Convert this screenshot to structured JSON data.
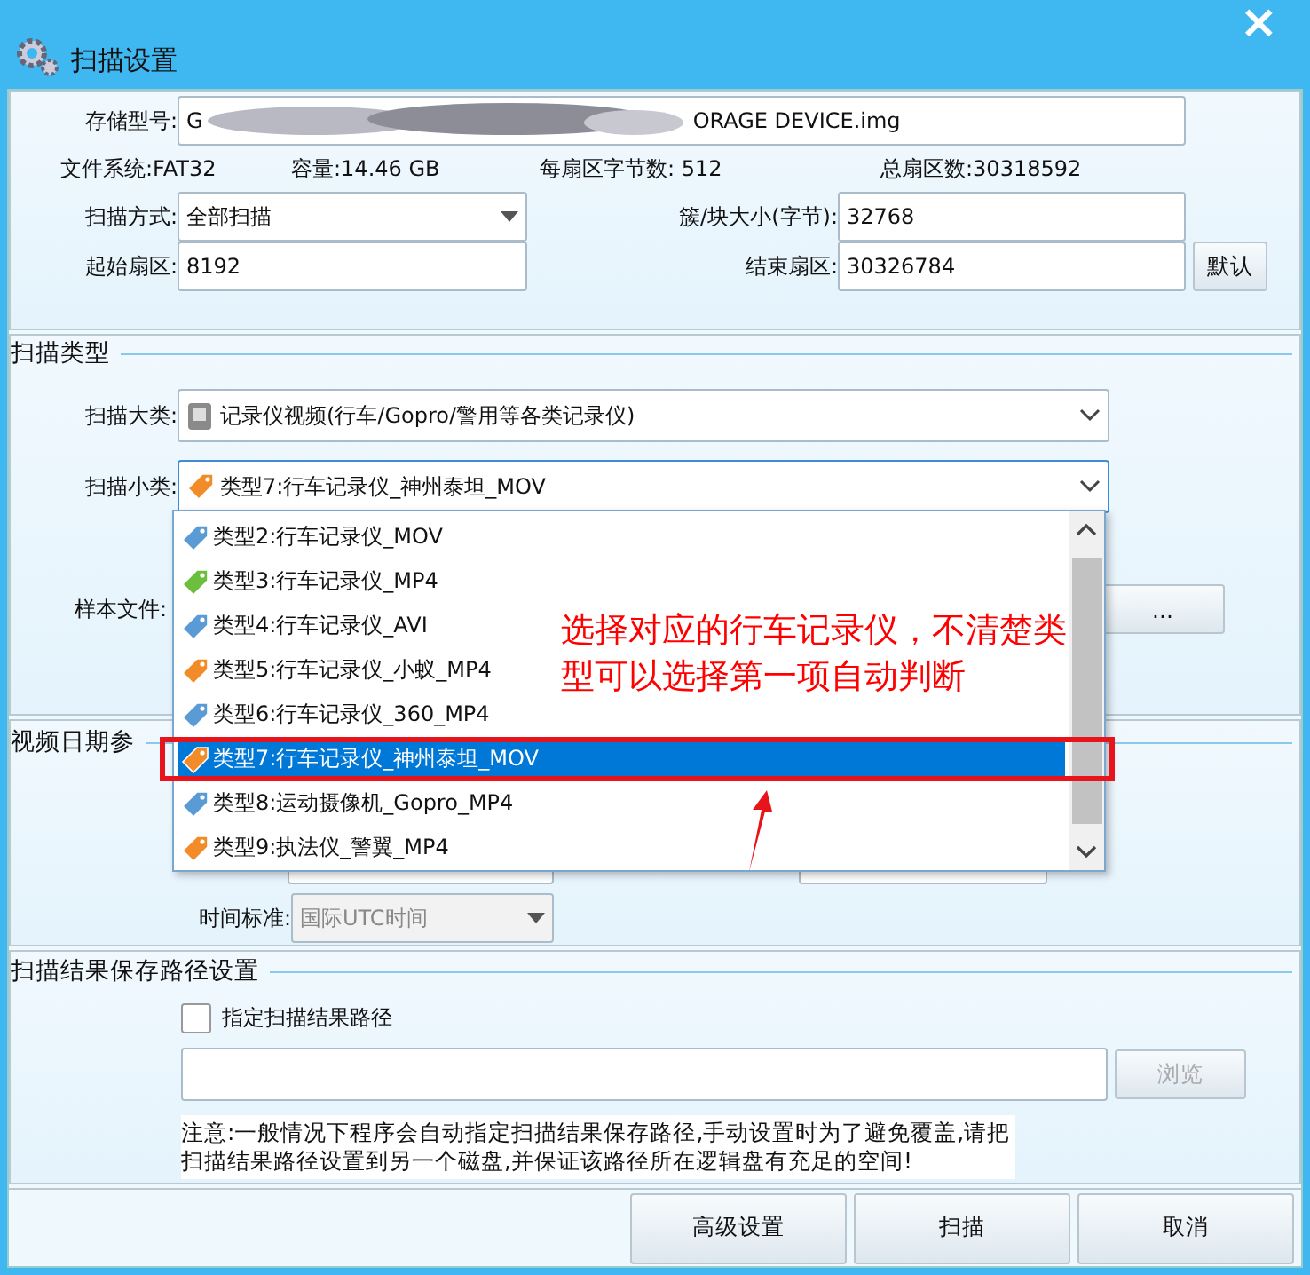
{
  "window": {
    "title": "扫描设置",
    "close": "×"
  },
  "device": {
    "storage_label": "存储型号:",
    "storage_prefix": "G",
    "storage_value": "ORAGE DEVICE.img",
    "info": [
      "文件系统:FAT32",
      "容量:14.46 GB",
      "每扇区字节数: 512",
      "总扇区数:30318592"
    ],
    "scan_mode_label": "扫描方式:",
    "scan_mode": "全部扫描",
    "cluster_label": "簇/块大小(字节):",
    "cluster": "32768",
    "start_label": "起始扇区:",
    "start": "8192",
    "end_label": "结束扇区:",
    "end": "30326784",
    "default_button": "默认"
  },
  "scan_type": {
    "title": "扫描类型",
    "major_label": "扫描大类:",
    "major": "记录仪视频(行车/Gopro/警用等各类记录仪)",
    "minor_label": "扫描小类:",
    "minor": "类型7:行车记录仪_神州泰坦_MOV",
    "minor_tag": {
      "color": "#f28c28"
    },
    "sample_label": "样本文件:",
    "sample_button": "...",
    "dropdown": {
      "expanded": true,
      "items": [
        {
          "label": "类型2:行车记录仪_MOV",
          "color": "#5b9bd5",
          "selected": false
        },
        {
          "label": "类型3:行车记录仪_MP4",
          "color": "#6cbf3c",
          "selected": false
        },
        {
          "label": "类型4:行车记录仪_AVI",
          "color": "#5b9bd5",
          "selected": false
        },
        {
          "label": "类型5:行车记录仪_小蚁_MP4",
          "color": "#f28c28",
          "selected": false
        },
        {
          "label": "类型6:行车记录仪_360_MP4",
          "color": "#5b9bd5",
          "selected": false
        },
        {
          "label": "类型7:行车记录仪_神州泰坦_MOV",
          "color": "#f28c28",
          "selected": true
        },
        {
          "label": "类型8:运动摄像机_Gopro_MP4",
          "color": "#5b9bd5",
          "selected": false
        },
        {
          "label": "类型9:执法仪_警翼_MP4",
          "color": "#f28c28",
          "selected": false
        }
      ]
    }
  },
  "annotation": "选择对应的行车记录仪，不清楚类型可以选择第一项自动判断",
  "video_date": {
    "title": "视频日期参",
    "time_label": "时间标准:",
    "time_value": "国际UTC时间",
    "disabled": true
  },
  "save_path": {
    "title": "扫描结果保存路径设置",
    "checkbox_label": "指定扫描结果路径",
    "checked": false,
    "browse_button": "浏览",
    "browse_disabled": true,
    "note": "注意:一般情况下程序会自动指定扫描结果保存路径,手动设置时为了避免覆盖,请把扫描结果路径设置到另一个磁盘,并保证该路径所在逻辑盘有充足的空间!"
  },
  "buttons": [
    "高级设置",
    "扫描",
    "取消"
  ]
}
